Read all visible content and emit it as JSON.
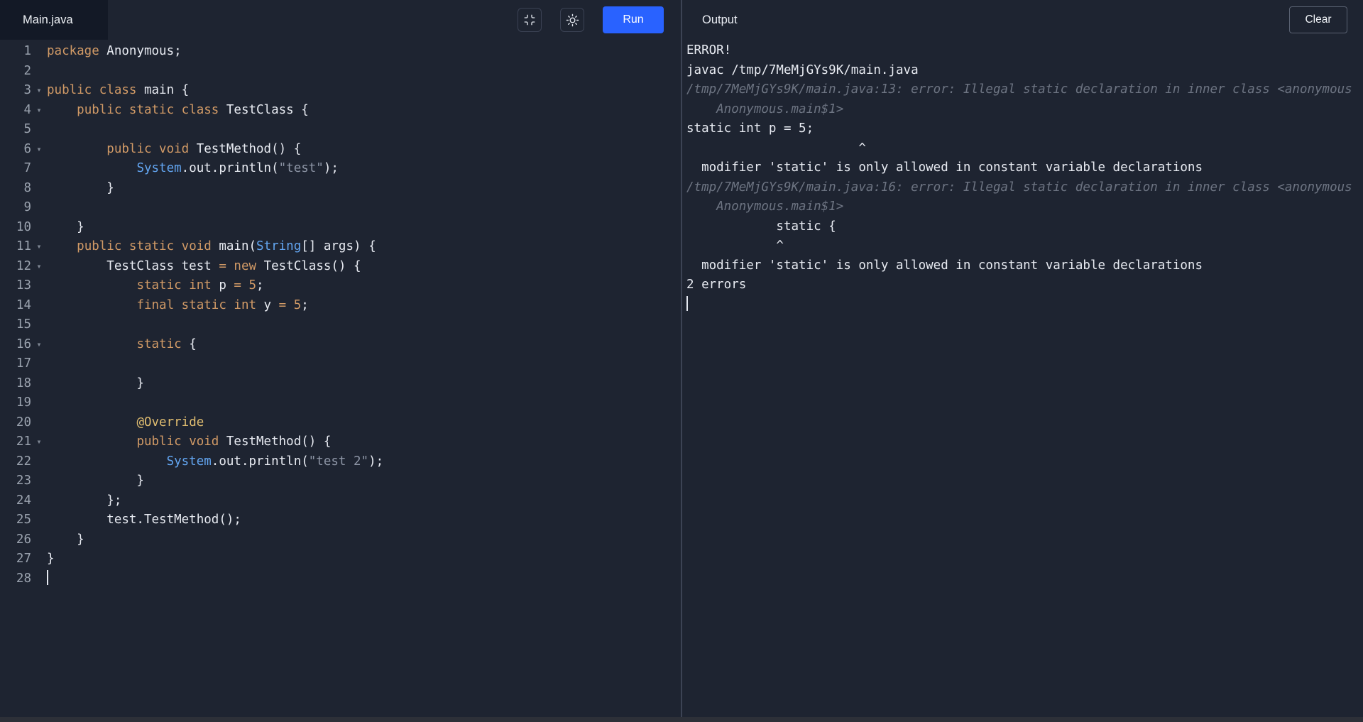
{
  "colors": {
    "accent": "#2962ff",
    "keyword": "#d19a66",
    "type": "#63a6f2",
    "string": "#8d95a5",
    "number": "#d19a66",
    "annotation": "#e0bd70",
    "background": "#1e2431",
    "tab_background": "#131926",
    "divider": "#3c4354"
  },
  "editor": {
    "tab_label": "Main.java",
    "run_label": "Run",
    "icons": [
      "fullscreen-icon",
      "light-theme-sun-icon"
    ],
    "lines": [
      {
        "n": 1,
        "fold": false,
        "tokens": [
          [
            "k",
            "package"
          ],
          [
            "p",
            " Anonymous;"
          ]
        ]
      },
      {
        "n": 2,
        "fold": false,
        "tokens": []
      },
      {
        "n": 3,
        "fold": true,
        "tokens": [
          [
            "k",
            "public class"
          ],
          [
            "p",
            " main {"
          ]
        ]
      },
      {
        "n": 4,
        "fold": true,
        "tokens": [
          [
            "p",
            "    "
          ],
          [
            "k",
            "public static class"
          ],
          [
            "p",
            " TestClass {"
          ]
        ]
      },
      {
        "n": 5,
        "fold": false,
        "tokens": []
      },
      {
        "n": 6,
        "fold": true,
        "tokens": [
          [
            "p",
            "        "
          ],
          [
            "k",
            "public void"
          ],
          [
            "p",
            " TestMethod() {"
          ]
        ]
      },
      {
        "n": 7,
        "fold": false,
        "tokens": [
          [
            "p",
            "            "
          ],
          [
            "t",
            "System"
          ],
          [
            "p",
            ".out.println("
          ],
          [
            "s",
            "\"test\""
          ],
          [
            "p",
            ");"
          ]
        ]
      },
      {
        "n": 8,
        "fold": false,
        "tokens": [
          [
            "p",
            "        }"
          ]
        ]
      },
      {
        "n": 9,
        "fold": false,
        "tokens": []
      },
      {
        "n": 10,
        "fold": false,
        "tokens": [
          [
            "p",
            "    }"
          ]
        ]
      },
      {
        "n": 11,
        "fold": true,
        "tokens": [
          [
            "p",
            "    "
          ],
          [
            "k",
            "public static void"
          ],
          [
            "p",
            " main("
          ],
          [
            "t",
            "String"
          ],
          [
            "p",
            "[] args) {"
          ]
        ]
      },
      {
        "n": 12,
        "fold": true,
        "tokens": [
          [
            "p",
            "        TestClass test "
          ],
          [
            "k",
            "="
          ],
          [
            "p",
            " "
          ],
          [
            "k",
            "new"
          ],
          [
            "p",
            " TestClass() {"
          ]
        ]
      },
      {
        "n": 13,
        "fold": false,
        "tokens": [
          [
            "p",
            "            "
          ],
          [
            "k",
            "static int"
          ],
          [
            "p",
            " p "
          ],
          [
            "k",
            "="
          ],
          [
            "p",
            " "
          ],
          [
            "n",
            "5"
          ],
          [
            "p",
            ";"
          ]
        ]
      },
      {
        "n": 14,
        "fold": false,
        "tokens": [
          [
            "p",
            "            "
          ],
          [
            "k",
            "final static int"
          ],
          [
            "p",
            " y "
          ],
          [
            "k",
            "="
          ],
          [
            "p",
            " "
          ],
          [
            "n",
            "5"
          ],
          [
            "p",
            ";"
          ]
        ]
      },
      {
        "n": 15,
        "fold": false,
        "tokens": []
      },
      {
        "n": 16,
        "fold": true,
        "tokens": [
          [
            "p",
            "            "
          ],
          [
            "k",
            "static"
          ],
          [
            "p",
            " {"
          ]
        ]
      },
      {
        "n": 17,
        "fold": false,
        "tokens": []
      },
      {
        "n": 18,
        "fold": false,
        "tokens": [
          [
            "p",
            "            }"
          ]
        ]
      },
      {
        "n": 19,
        "fold": false,
        "tokens": []
      },
      {
        "n": 20,
        "fold": false,
        "tokens": [
          [
            "p",
            "            "
          ],
          [
            "a",
            "@Override"
          ]
        ]
      },
      {
        "n": 21,
        "fold": true,
        "tokens": [
          [
            "p",
            "            "
          ],
          [
            "k",
            "public void"
          ],
          [
            "p",
            " TestMethod() {"
          ]
        ]
      },
      {
        "n": 22,
        "fold": false,
        "tokens": [
          [
            "p",
            "                "
          ],
          [
            "t",
            "System"
          ],
          [
            "p",
            ".out.println("
          ],
          [
            "s",
            "\"test 2\""
          ],
          [
            "p",
            ");"
          ]
        ]
      },
      {
        "n": 23,
        "fold": false,
        "tokens": [
          [
            "p",
            "            }"
          ]
        ]
      },
      {
        "n": 24,
        "fold": false,
        "tokens": [
          [
            "p",
            "        };"
          ]
        ]
      },
      {
        "n": 25,
        "fold": false,
        "tokens": [
          [
            "p",
            "        test.TestMethod();"
          ]
        ]
      },
      {
        "n": 26,
        "fold": false,
        "tokens": [
          [
            "p",
            "    }"
          ]
        ]
      },
      {
        "n": 27,
        "fold": false,
        "tokens": [
          [
            "p",
            "}"
          ]
        ]
      },
      {
        "n": 28,
        "fold": false,
        "tokens": [],
        "cursor": true
      }
    ]
  },
  "output": {
    "title": "Output",
    "clear_label": "Clear",
    "lines": [
      {
        "style": "plain",
        "text": "ERROR!"
      },
      {
        "style": "plain",
        "text": "javac /tmp/7MeMjGYs9K/main.java"
      },
      {
        "style": "dim",
        "text": "/tmp/7MeMjGYs9K/main.java:13: error: Illegal static declaration in inner class <anonymous"
      },
      {
        "style": "dim",
        "text": "    Anonymous.main$1>"
      },
      {
        "style": "plain",
        "text": "static int p = 5;"
      },
      {
        "style": "plain",
        "text": "                       ^"
      },
      {
        "style": "plain",
        "text": "  modifier 'static' is only allowed in constant variable declarations"
      },
      {
        "style": "dim",
        "text": "/tmp/7MeMjGYs9K/main.java:16: error: Illegal static declaration in inner class <anonymous"
      },
      {
        "style": "dim",
        "text": "    Anonymous.main$1>"
      },
      {
        "style": "plain",
        "text": "            static {"
      },
      {
        "style": "plain",
        "text": "            ^"
      },
      {
        "style": "plain",
        "text": "  modifier 'static' is only allowed in constant variable declarations"
      },
      {
        "style": "plain",
        "text": "2 errors"
      },
      {
        "style": "cursor",
        "text": ""
      }
    ]
  }
}
